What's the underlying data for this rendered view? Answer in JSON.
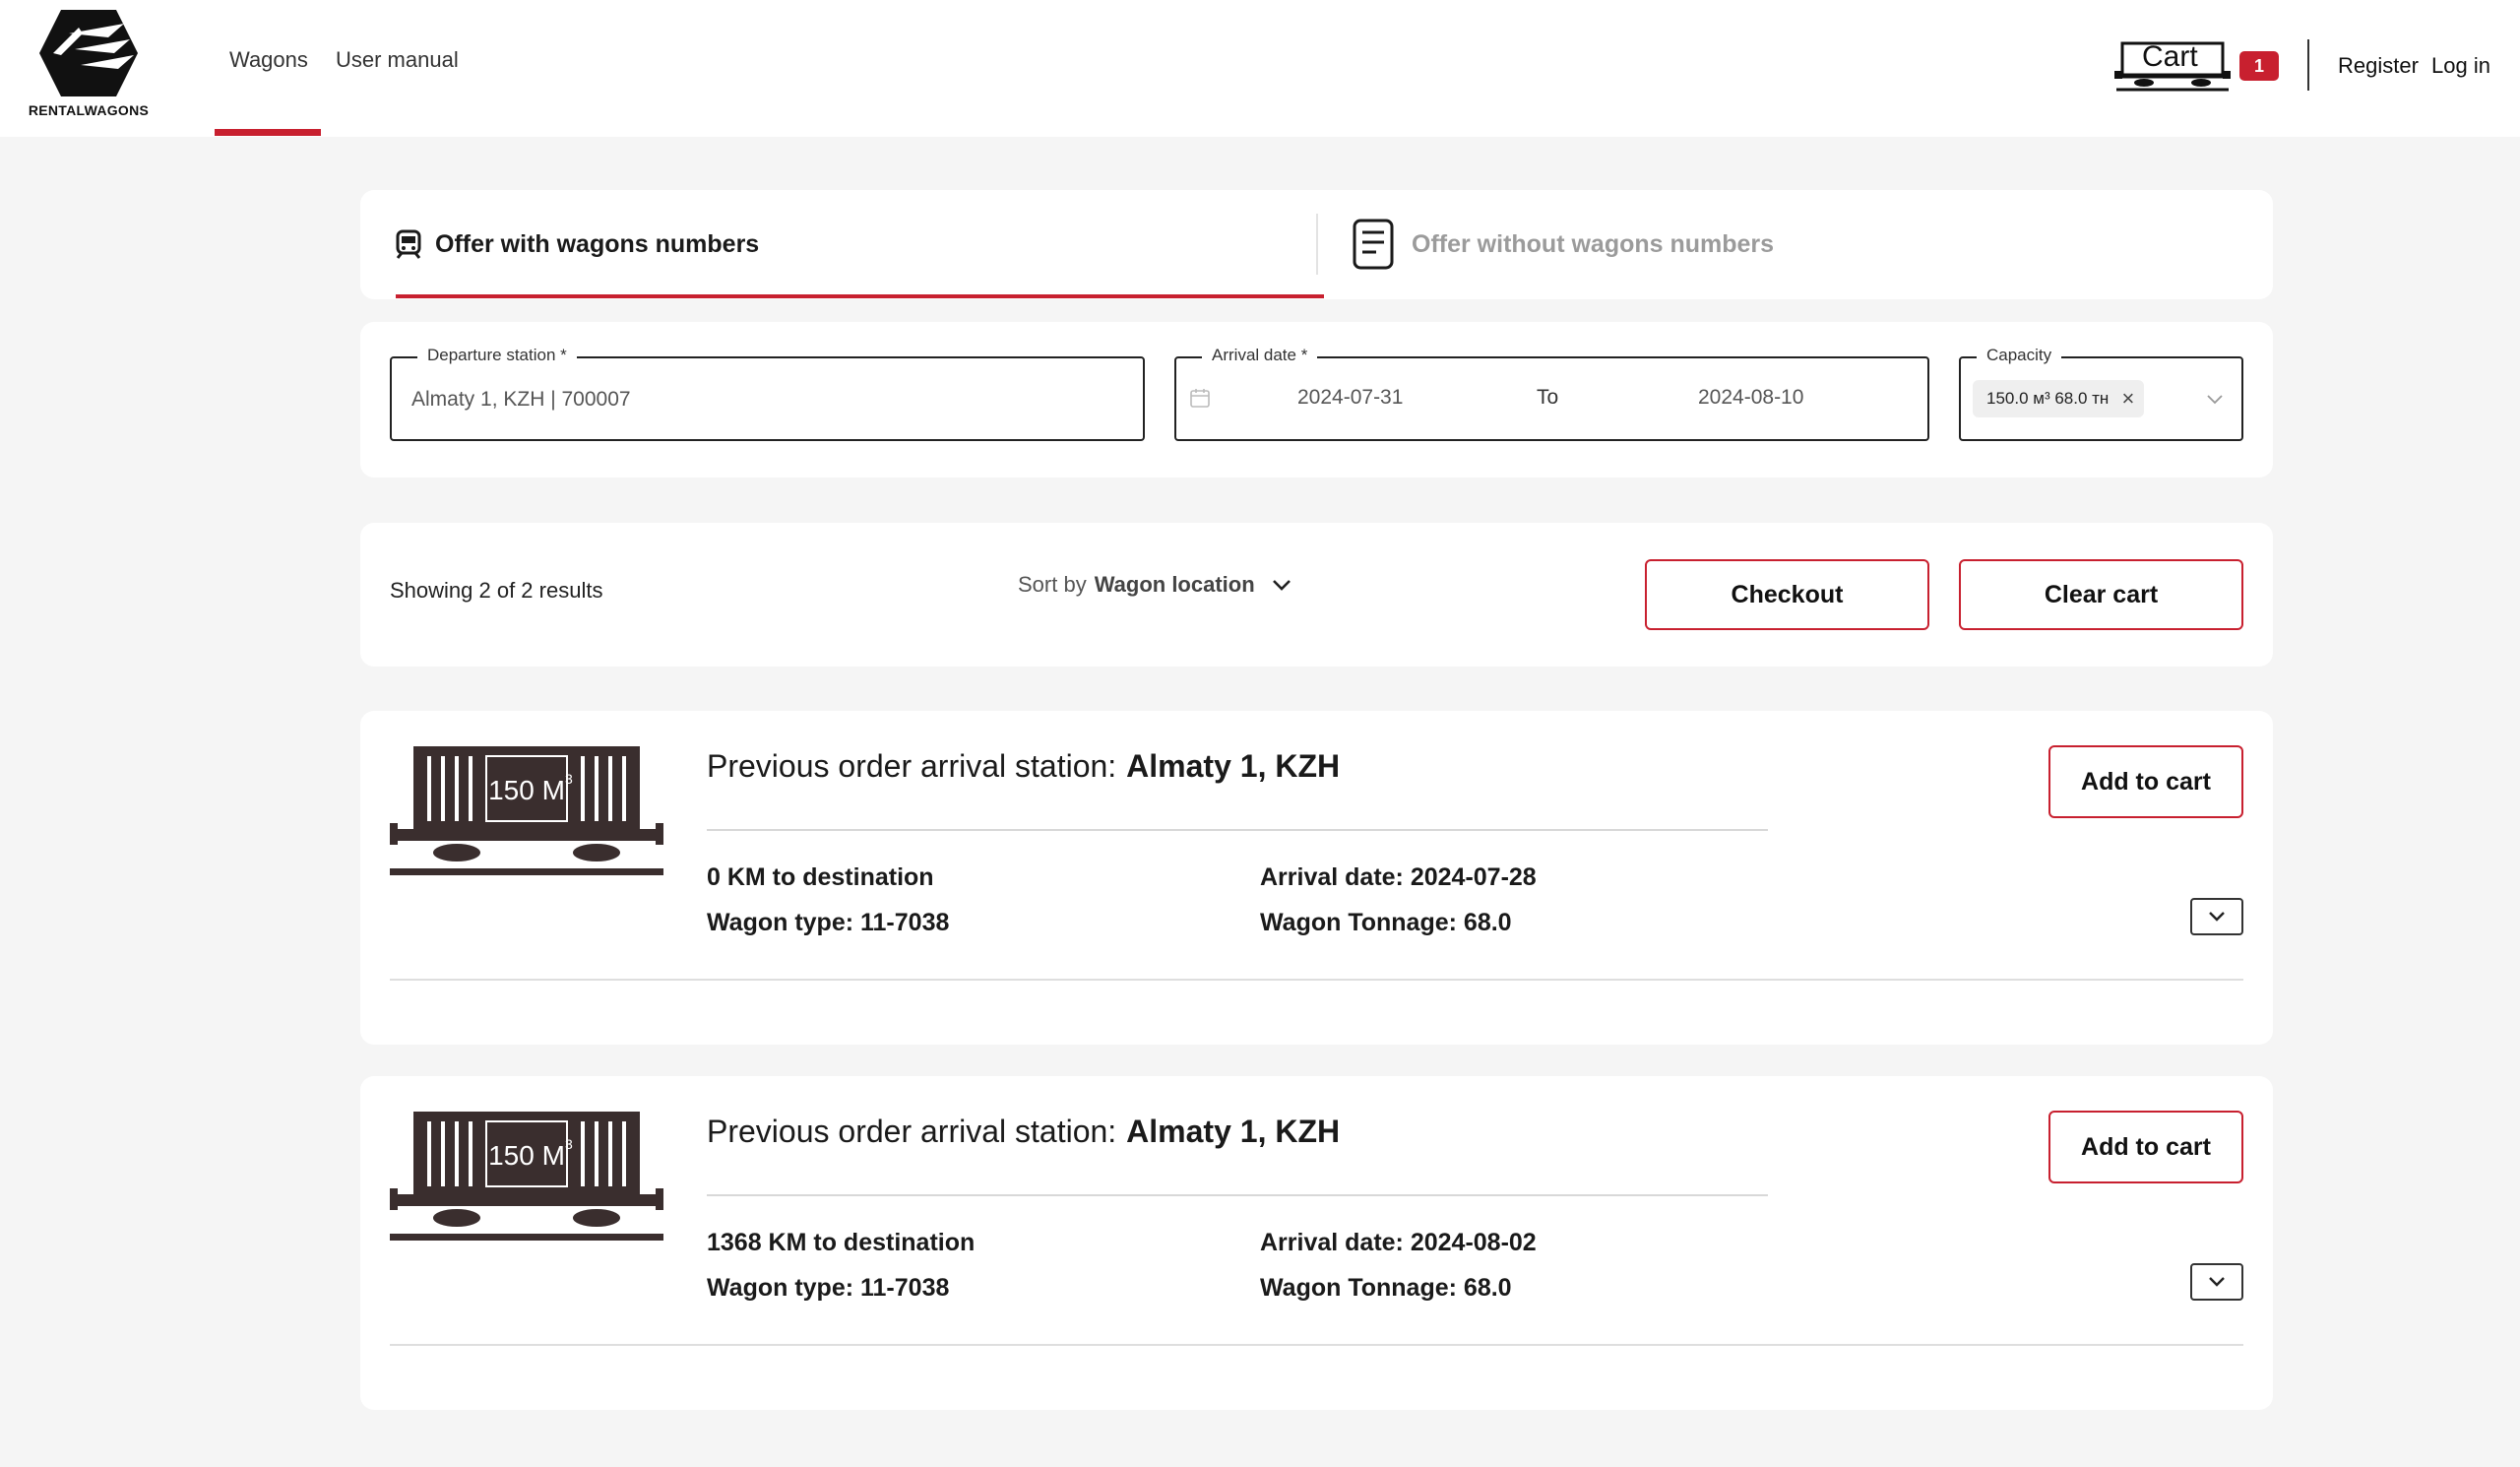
{
  "brand": {
    "name": "RENTALWAGONS"
  },
  "nav": {
    "items": [
      {
        "label": "Wagons",
        "active": true
      },
      {
        "label": "User manual",
        "active": false
      }
    ]
  },
  "header": {
    "cart_label": "Cart",
    "cart_count": "1",
    "register": "Register",
    "login": "Log in"
  },
  "tabs": [
    {
      "label": "Offer with wagons numbers",
      "icon": "train-icon",
      "active": true
    },
    {
      "label": "Offer without wagons numbers",
      "icon": "document-icon",
      "active": false
    }
  ],
  "filters": {
    "departure": {
      "label": "Departure station *",
      "value": "Almaty 1, KZH | 700007"
    },
    "arrival": {
      "label": "Arrival date *",
      "from": "2024-07-31",
      "to_label": "To",
      "to": "2024-08-10"
    },
    "capacity": {
      "label": "Capacity",
      "chip": "150.0 м³ 68.0 тн"
    }
  },
  "results": {
    "summary": "Showing 2 of 2 results",
    "sort_prefix": "Sort by",
    "sort_value": "Wagon location",
    "checkout": "Checkout",
    "clear_cart": "Clear cart"
  },
  "offers": [
    {
      "capacity_label": "150 M",
      "title_prefix": "Previous order arrival station:",
      "station": "Almaty 1, KZH",
      "distance": "0 KM to destination",
      "wagon_type": "Wagon type: 11-7038",
      "arrival_date": "Arrival date: 2024-07-28",
      "tonnage": "Wagon Tonnage: 68.0",
      "add_label": "Add to cart"
    },
    {
      "capacity_label": "150 M",
      "title_prefix": "Previous order arrival station:",
      "station": "Almaty 1, KZH",
      "distance": "1368 KM to destination",
      "wagon_type": "Wagon type: 11-7038",
      "arrival_date": "Arrival date: 2024-08-02",
      "tonnage": "Wagon Tonnage: 68.0",
      "add_label": "Add to cart"
    }
  ],
  "colors": {
    "accent": "#c8202f",
    "background": "#f5f5f5"
  }
}
